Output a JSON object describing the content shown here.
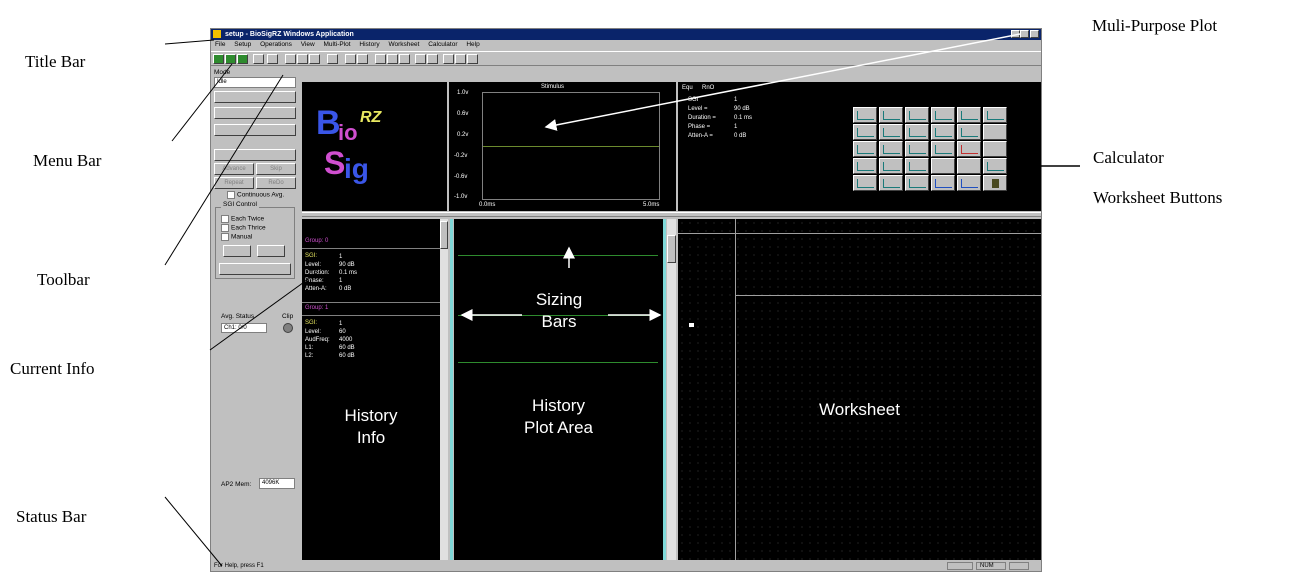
{
  "callouts": {
    "title_bar": "Title Bar",
    "menu_bar": "Menu Bar",
    "toolbar": "Toolbar",
    "current_info": "Current Info",
    "status_bar": "Status Bar",
    "multi_plot": "Muli-Purpose Plot",
    "calculator_line1": "Calculator",
    "calculator_line2": "Worksheet Buttons",
    "sizing_line1": "Sizing",
    "sizing_line2": "Bars",
    "history_info_line1": "History",
    "history_info_line2": "Info",
    "history_plot_line1": "History",
    "history_plot_line2": "Plot Area",
    "worksheet": "Worksheet"
  },
  "window": {
    "title": "setup - BioSigRZ Windows Application"
  },
  "menu": [
    "File",
    "Setup",
    "Operations",
    "View",
    "Multi-Plot",
    "History",
    "Worksheet",
    "Calculator",
    "Help"
  ],
  "left_panel": {
    "mode_label": "Mode",
    "mode_value": "Idle",
    "advance": "Advance",
    "skip": "Skip",
    "repeat": "Repeat",
    "redo": "ReDo",
    "continuous_avg": "Continuous Avg.",
    "sgi_control": "SGI Control",
    "each_twice": "Each Twice",
    "each_thrice": "Each Thrice",
    "manual": "Manual",
    "avg_status": "Avg. Status",
    "clip": "Clip",
    "ch1": "Ch1:  0/0",
    "ap2_mem_label": "AP2 Mem:",
    "ap2_mem_value": "4096K"
  },
  "logo": {
    "letters": "BioSig",
    "suffix": "RZ"
  },
  "stimulus_plot": {
    "title": "Stimulus",
    "y_ticks": [
      "1.0v",
      "0.6v",
      "0.2v",
      "-0.2v",
      "-0.6v",
      "-1.0v"
    ],
    "x_ticks": [
      "0.0ms",
      "5.0ms"
    ]
  },
  "info_panel": {
    "header": [
      "Equ",
      "RnO"
    ],
    "rows": [
      {
        "k": "SGI",
        "v": "1"
      },
      {
        "k": "Level =",
        "v": "90 dB"
      },
      {
        "k": "Duration =",
        "v": "0.1 ms"
      },
      {
        "k": "Phase =",
        "v": "1"
      },
      {
        "k": "Atten-A =",
        "v": "0 dB"
      }
    ]
  },
  "history_info": {
    "group0": "Group: 0",
    "g0_rows": [
      {
        "k": "SGI:",
        "v": "1"
      },
      {
        "k": "Level:",
        "v": "90  dB"
      },
      {
        "k": "Duration:",
        "v": "0.1  ms"
      },
      {
        "k": "Phase:",
        "v": "1"
      },
      {
        "k": "Atten-A:",
        "v": "0  dB"
      }
    ],
    "group1": "Group: 1",
    "g1_rows": [
      {
        "k": "SGI:",
        "v": "1"
      },
      {
        "k": "Level:",
        "v": "60"
      },
      {
        "k": "AudFreq:",
        "v": "4000"
      },
      {
        "k": "L1:",
        "v": "60  dB"
      },
      {
        "k": "L2:",
        "v": "60  dB"
      }
    ]
  },
  "status": {
    "help": "For Help, press F1",
    "num": "NUM"
  },
  "colors": {
    "titlebar": "#0a246a",
    "panel": "#c0c0c0",
    "plot_bg": "#000000",
    "trace": "#2e8b2e",
    "sizing_bar": "#7fd8d8"
  }
}
